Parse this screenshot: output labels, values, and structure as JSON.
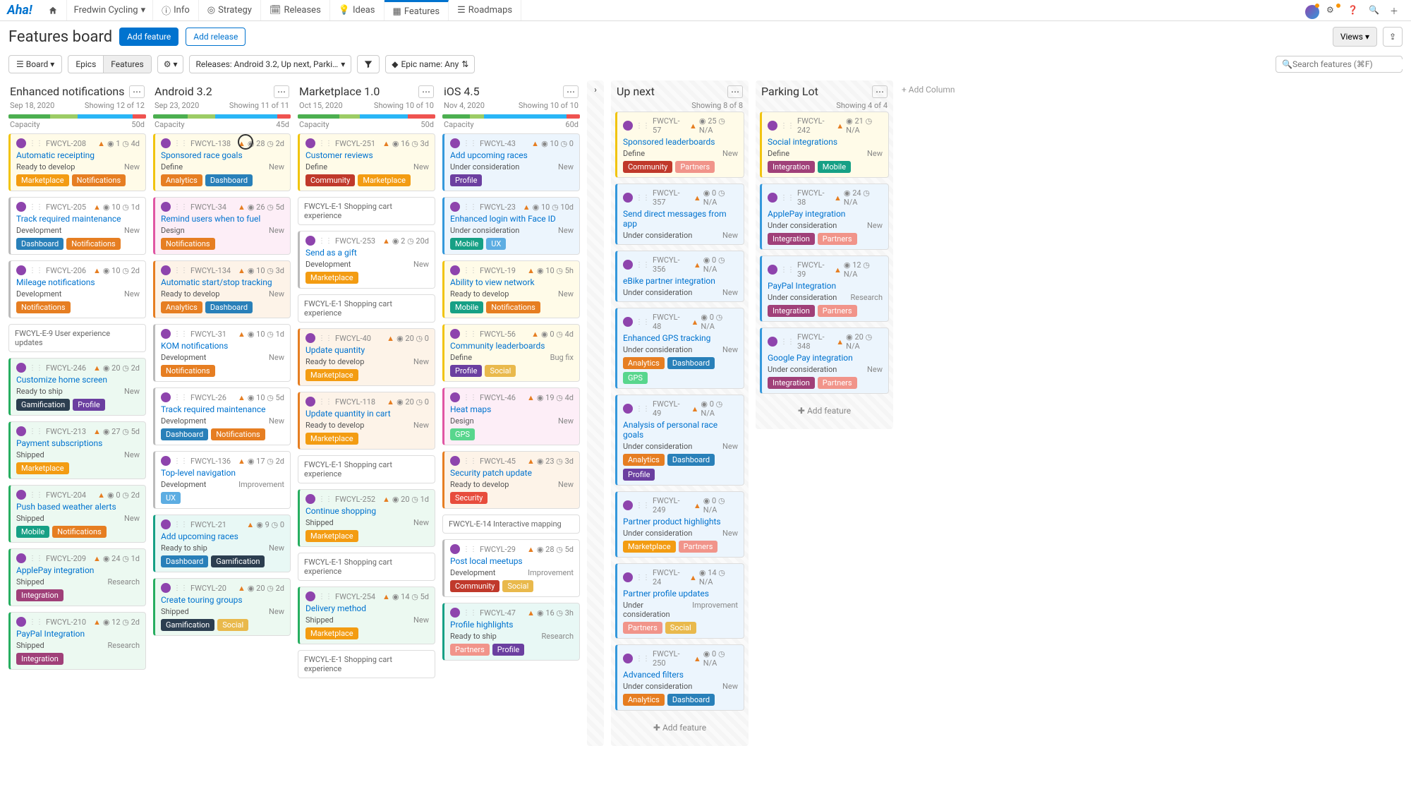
{
  "workspace": "Fredwin Cycling",
  "nav": {
    "info": "Info",
    "strategy": "Strategy",
    "releases": "Releases",
    "ideas": "Ideas",
    "features": "Features",
    "roadmaps": "Roadmaps"
  },
  "page_title": "Features board",
  "buttons": {
    "add_feature": "Add feature",
    "add_release": "Add release",
    "views": "Views"
  },
  "view_toggle": {
    "board": "Board",
    "epics": "Epics",
    "features": "Features"
  },
  "filters": {
    "releases": "Releases: Android 3.2, Up next, Parki…",
    "epic_name": "Epic name: Any"
  },
  "search_placeholder": "Search features (⌘F)",
  "capacity_label": "Capacity",
  "add_column_label": "+ Add Column",
  "add_feature_row_label": "Add feature",
  "tag_colors": {
    "Marketplace": "#f39c12",
    "Notifications": "#e67e22",
    "Dashboard": "#2980b9",
    "Analytics": "#e67e22",
    "Community": "#c0392b",
    "Profile": "#6b3fa0",
    "Mobile": "#16a085",
    "UX": "#5dade2",
    "Gamification": "#2c3e50",
    "Integration": "#a04079",
    "Partners": "#f1948a",
    "Social": "#e9b94c",
    "GPS": "#58d68d",
    "Security": "#e74c3c"
  },
  "columns": [
    {
      "id": "enh",
      "name": "Enhanced notifications",
      "date": "Sep 18, 2020",
      "showing": "Showing 12 of 12",
      "cap": "50d",
      "cap_segs": [
        [
          "#4caf50",
          30
        ],
        [
          "#9ccc65",
          20
        ],
        [
          "#29b6f6",
          40
        ],
        [
          "#ef5350",
          10
        ]
      ],
      "cards": [
        [
          "c-yellow",
          "FWCYL-208",
          "Automatic receipting",
          "Ready to develop",
          "New",
          "1",
          "4d",
          [
            "Marketplace",
            "Notifications"
          ]
        ],
        [
          "c-white",
          "FWCYL-205",
          "Track required maintenance",
          "Development",
          "New",
          "10",
          "1d",
          [
            "Dashboard",
            "Notifications"
          ]
        ],
        [
          "c-white",
          "FWCYL-206",
          "Mileage notifications",
          "Development",
          "New",
          "10",
          "2d",
          [
            "Notifications"
          ]
        ],
        [
          "epic",
          "FWCYL-E-9 User experience updates"
        ],
        [
          "c-green",
          "FWCYL-246",
          "Customize home screen",
          "Ready to ship",
          "New",
          "20",
          "2d",
          [
            "Gamification",
            "Profile"
          ]
        ],
        [
          "c-green",
          "FWCYL-213",
          "Payment subscriptions",
          "Shipped",
          "New",
          "27",
          "5d",
          [
            "Marketplace"
          ]
        ],
        [
          "c-green",
          "FWCYL-204",
          "Push based weather alerts",
          "Shipped",
          "New",
          "0",
          "2d",
          [
            "Mobile",
            "Notifications"
          ]
        ],
        [
          "c-green",
          "FWCYL-209",
          "ApplePay integration",
          "Shipped",
          "Research",
          "24",
          "1d",
          [
            "Integration"
          ]
        ],
        [
          "c-green",
          "FWCYL-210",
          "PayPal Integration",
          "Shipped",
          "Research",
          "12",
          "2d",
          [
            "Integration"
          ]
        ]
      ]
    },
    {
      "id": "android",
      "name": "Android 3.2",
      "date": "Sep 23, 2020",
      "showing": "Showing 11 of 11",
      "cap": "45d",
      "cap_segs": [
        [
          "#4caf50",
          25
        ],
        [
          "#9ccc65",
          20
        ],
        [
          "#29b6f6",
          45
        ],
        [
          "#ef5350",
          10
        ]
      ],
      "cards": [
        [
          "c-yellow",
          "FWCYL-138",
          "Sponsored race goals",
          "Define",
          "New",
          "28",
          "2d",
          [
            "Analytics",
            "Dashboard"
          ]
        ],
        [
          "c-pink",
          "FWCYL-34",
          "Remind users when to fuel",
          "Design",
          "New",
          "26",
          "5d",
          [
            "Notifications"
          ]
        ],
        [
          "c-orange",
          "FWCYL-134",
          "Automatic start/stop tracking",
          "Ready to develop",
          "New",
          "10",
          "3d",
          [
            "Analytics",
            "Dashboard"
          ]
        ],
        [
          "c-white",
          "FWCYL-31",
          "KOM notifications",
          "Development",
          "New",
          "10",
          "1d",
          [
            "Notifications"
          ]
        ],
        [
          "c-white",
          "FWCYL-26",
          "Track required maintenance",
          "Development",
          "New",
          "10",
          "5d",
          [
            "Dashboard",
            "Notifications"
          ]
        ],
        [
          "c-white",
          "FWCYL-136",
          "Top-level navigation",
          "Development",
          "Improvement",
          "17",
          "2d",
          [
            "UX"
          ]
        ],
        [
          "c-teal",
          "FWCYL-21",
          "Add upcoming races",
          "Ready to ship",
          "New",
          "9",
          "0",
          [
            "Dashboard",
            "Gamification"
          ]
        ],
        [
          "c-green",
          "FWCYL-20",
          "Create touring groups",
          "Shipped",
          "New",
          "20",
          "2d",
          [
            "Gamification",
            "Social"
          ]
        ]
      ]
    },
    {
      "id": "market",
      "name": "Marketplace 1.0",
      "date": "Oct 15, 2020",
      "showing": "Showing 10 of 10",
      "cap": "50d",
      "cap_segs": [
        [
          "#4caf50",
          30
        ],
        [
          "#9ccc65",
          15
        ],
        [
          "#29b6f6",
          35
        ],
        [
          "#ef5350",
          20
        ]
      ],
      "cards": [
        [
          "c-yellow",
          "FWCYL-251",
          "Customer reviews",
          "Define",
          "New",
          "16",
          "3d",
          [
            "Community",
            "Marketplace"
          ]
        ],
        [
          "epic",
          "FWCYL-E-1 Shopping cart experience"
        ],
        [
          "c-white",
          "FWCYL-253",
          "Send as a gift",
          "Development",
          "New",
          "2",
          "20d",
          [
            "Marketplace"
          ]
        ],
        [
          "epic",
          "FWCYL-E-1 Shopping cart experience"
        ],
        [
          "c-orange",
          "FWCYL-40",
          "Update quantity",
          "Ready to develop",
          "New",
          "20",
          "0",
          [
            "Marketplace"
          ]
        ],
        [
          "c-orange",
          "FWCYL-118",
          "Update quantity in cart",
          "Ready to develop",
          "New",
          "20",
          "0",
          [
            "Marketplace"
          ]
        ],
        [
          "epic",
          "FWCYL-E-1 Shopping cart experience"
        ],
        [
          "c-green",
          "FWCYL-252",
          "Continue shopping",
          "Shipped",
          "New",
          "20",
          "1d",
          [
            "Marketplace"
          ]
        ],
        [
          "epic",
          "FWCYL-E-1 Shopping cart experience"
        ],
        [
          "c-green",
          "FWCYL-254",
          "Delivery method",
          "Shipped",
          "New",
          "14",
          "5d",
          [
            "Marketplace"
          ]
        ],
        [
          "epic",
          "FWCYL-E-1 Shopping cart experience"
        ]
      ]
    },
    {
      "id": "ios",
      "name": "iOS 4.5",
      "date": "Nov 4, 2020",
      "showing": "Showing 10 of 10",
      "cap": "60d",
      "cap_segs": [
        [
          "#4caf50",
          20
        ],
        [
          "#9ccc65",
          10
        ],
        [
          "#29b6f6",
          60
        ],
        [
          "#ef5350",
          10
        ]
      ],
      "cards": [
        [
          "c-blue",
          "FWCYL-43",
          "Add upcoming races",
          "Under consideration",
          "New",
          "10",
          "0",
          [
            "Profile"
          ]
        ],
        [
          "c-blue",
          "FWCYL-23",
          "Enhanced login with Face ID",
          "Under consideration",
          "New",
          "10",
          "10d",
          [
            "Mobile",
            "UX"
          ]
        ],
        [
          "c-yellow",
          "FWCYL-19",
          "Ability to view network",
          "Ready to develop",
          "New",
          "10",
          "5h",
          [
            "Mobile",
            "Notifications"
          ]
        ],
        [
          "c-yellow",
          "FWCYL-56",
          "Community leaderboards",
          "Define",
          "Bug fix",
          "0",
          "4d",
          [
            "Profile",
            "Social"
          ]
        ],
        [
          "c-pink",
          "FWCYL-46",
          "Heat maps",
          "Design",
          "New",
          "19",
          "4d",
          [
            "GPS"
          ]
        ],
        [
          "c-orange",
          "FWCYL-45",
          "Security patch update",
          "Ready to develop",
          "New",
          "23",
          "3d",
          [
            "Security"
          ]
        ],
        [
          "epic",
          "FWCYL-E-14 Interactive mapping"
        ],
        [
          "c-white",
          "FWCYL-29",
          "Post local meetups",
          "Development",
          "Improvement",
          "28",
          "5d",
          [
            "Community",
            "Social"
          ]
        ],
        [
          "c-teal",
          "FWCYL-47",
          "Profile highlights",
          "Ready to ship",
          "Research",
          "16",
          "3h",
          [
            "Partners",
            "Profile"
          ]
        ]
      ]
    },
    {
      "id": "upnext",
      "name": "Up next",
      "future": true,
      "showing": "Showing 8 of 8",
      "cards": [
        [
          "c-yellow",
          "FWCYL-57",
          "Sponsored leaderboards",
          "Define",
          "New",
          "25",
          "N/A",
          [
            "Community",
            "Partners"
          ]
        ],
        [
          "c-blue",
          "FWCYL-357",
          "Send direct messages from app",
          "Under consideration",
          "New",
          "0",
          "N/A",
          []
        ],
        [
          "c-blue",
          "FWCYL-356",
          "eBike partner integration",
          "Under consideration",
          "New",
          "0",
          "N/A",
          []
        ],
        [
          "c-blue",
          "FWCYL-48",
          "Enhanced GPS tracking",
          "Under consideration",
          "New",
          "0",
          "N/A",
          [
            "Analytics",
            "Dashboard",
            "GPS"
          ]
        ],
        [
          "c-blue",
          "FWCYL-49",
          "Analysis of personal race goals",
          "Under consideration",
          "New",
          "0",
          "N/A",
          [
            "Analytics",
            "Dashboard",
            "Profile"
          ]
        ],
        [
          "c-blue",
          "FWCYL-249",
          "Partner product highlights",
          "Under consideration",
          "New",
          "0",
          "N/A",
          [
            "Marketplace",
            "Partners"
          ]
        ],
        [
          "c-blue",
          "FWCYL-24",
          "Partner profile updates",
          "Under consideration",
          "Improvement",
          "14",
          "N/A",
          [
            "Partners",
            "Social"
          ]
        ],
        [
          "c-blue",
          "FWCYL-250",
          "Advanced filters",
          "Under consideration",
          "New",
          "0",
          "N/A",
          [
            "Analytics",
            "Dashboard"
          ]
        ]
      ]
    },
    {
      "id": "parking",
      "name": "Parking Lot",
      "future": true,
      "showing": "Showing 4 of 4",
      "cards": [
        [
          "c-yellow",
          "FWCYL-242",
          "Social integrations",
          "Define",
          "New",
          "21",
          "N/A",
          [
            "Integration",
            "Mobile"
          ]
        ],
        [
          "c-blue",
          "FWCYL-38",
          "ApplePay integration",
          "Under consideration",
          "New",
          "24",
          "N/A",
          [
            "Integration",
            "Partners"
          ]
        ],
        [
          "c-blue",
          "FWCYL-39",
          "PayPal Integration",
          "Under consideration",
          "Research",
          "12",
          "N/A",
          [
            "Integration",
            "Partners"
          ]
        ],
        [
          "c-blue",
          "FWCYL-348",
          "Google Pay integration",
          "Under consideration",
          "New",
          "20",
          "N/A",
          [
            "Integration",
            "Partners"
          ]
        ]
      ]
    }
  ]
}
